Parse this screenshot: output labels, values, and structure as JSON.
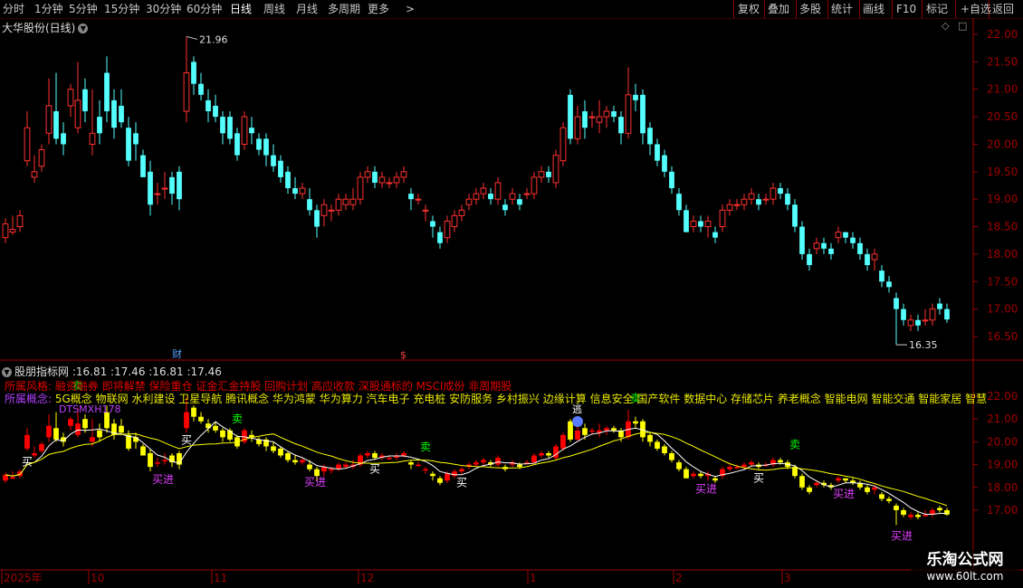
{
  "toolbar": {
    "periods": [
      "分时",
      "1分钟",
      "5分钟",
      "15分钟",
      "30分钟",
      "60分钟",
      "日线",
      "周线",
      "月线",
      "多周期",
      "更多"
    ],
    "active_period": "日线",
    "more_arrow": ">",
    "buttons": [
      "复权",
      "叠加",
      "多股",
      "统计",
      "画线",
      "F10",
      "标记",
      "+自选",
      "返回"
    ]
  },
  "main_panel": {
    "title": "大华股份(日线)",
    "price_ticks": [
      "22.00",
      "21.50",
      "21.00",
      "20.50",
      "20.00",
      "19.50",
      "19.00",
      "18.50",
      "18.00",
      "17.50",
      "17.00",
      "16.50"
    ],
    "high_label": "21.96",
    "low_label": "16.35",
    "event_markers": [
      "财",
      "$"
    ]
  },
  "indicator_panel": {
    "title": "股朋指标网",
    "values": ":16.81 :17.46 :16.81 :17.46",
    "style_label": "所属风格:",
    "style_text": "融资融券 即将解禁 保险重仓 证金汇金持股 回购计划 高应收款 深股通标的 MSCI成份 非周期股",
    "concept_label": "所属概念:",
    "concept_text": "5G概念 物联网 水利建设 卫星导航 腾讯概念 华为鸿蒙 华为算力 汽车电子 充电桩 安防服务 乡村振兴 边缘计算 信息安全 国产软件 数据中心 存储芯片 养老概念 智能电网 智能交通 智能家居 智慧",
    "indicator_name": "DTSMXH178",
    "price_ticks": [
      "22.00",
      "21.00",
      "20.00",
      "19.00",
      "18.00",
      "17.00"
    ],
    "signals": {
      "buy": "买",
      "sell": "卖",
      "buy_in": "买进",
      "escape": "逃"
    }
  },
  "x_axis": {
    "labels": [
      "2025年",
      "10",
      "11",
      "12",
      "1",
      "2",
      "3"
    ]
  },
  "watermark": {
    "line1": "乐淘公式网",
    "line2": "www.60lt.com"
  },
  "colors": {
    "up": "#ff3030",
    "down": "#54ffff",
    "ind_up": "#ff0000",
    "ind_down": "#ffff00",
    "ma_fast": "#ffffff",
    "ma_slow": "#ffff00",
    "border": "#a00000"
  },
  "chart_data": {
    "type": "candlestick",
    "ylim": [
      16.2,
      22.2
    ],
    "candles": [
      [
        18.3,
        18.55,
        18.65,
        18.2
      ],
      [
        18.4,
        18.45,
        18.7,
        18.35
      ],
      [
        18.5,
        18.7,
        18.8,
        18.4
      ],
      [
        19.7,
        20.3,
        20.6,
        19.6
      ],
      [
        19.4,
        19.5,
        19.8,
        19.3
      ],
      [
        19.6,
        19.9,
        20.0,
        19.5
      ],
      [
        20.2,
        20.7,
        21.2,
        20.0
      ],
      [
        20.6,
        20.1,
        21.3,
        20.0
      ],
      [
        20.2,
        20.0,
        20.4,
        19.8
      ],
      [
        20.7,
        21.0,
        21.1,
        20.5
      ],
      [
        20.3,
        20.8,
        21.5,
        20.2
      ],
      [
        21.0,
        20.6,
        21.2,
        20.4
      ],
      [
        20.0,
        20.2,
        21.0,
        19.8
      ],
      [
        20.5,
        20.2,
        20.8,
        20.0
      ],
      [
        21.3,
        20.6,
        21.6,
        20.4
      ],
      [
        20.8,
        20.3,
        21.0,
        20.1
      ],
      [
        20.7,
        20.4,
        21.0,
        20.3
      ],
      [
        20.3,
        19.7,
        20.5,
        19.6
      ],
      [
        20.2,
        20.0,
        20.4,
        19.7
      ],
      [
        19.8,
        19.4,
        19.9,
        19.4
      ],
      [
        19.5,
        18.9,
        19.7,
        18.7
      ],
      [
        19.1,
        19.1,
        19.3,
        18.9
      ],
      [
        19.2,
        19.2,
        19.5,
        19.0
      ],
      [
        19.4,
        19.1,
        19.5,
        18.9
      ],
      [
        19.5,
        19.0,
        19.6,
        18.8
      ],
      [
        20.6,
        21.3,
        21.96,
        20.4
      ],
      [
        21.5,
        21.1,
        21.6,
        20.9
      ],
      [
        21.1,
        20.9,
        21.3,
        20.8
      ],
      [
        20.8,
        20.6,
        21.0,
        20.4
      ],
      [
        20.7,
        20.5,
        20.9,
        20.4
      ],
      [
        20.5,
        20.2,
        20.6,
        20.0
      ],
      [
        20.5,
        20.1,
        20.6,
        20.0
      ],
      [
        20.2,
        19.8,
        20.3,
        19.7
      ],
      [
        20.0,
        20.5,
        20.6,
        19.9
      ],
      [
        20.3,
        20.2,
        20.5,
        20.0
      ],
      [
        20.1,
        19.9,
        20.2,
        19.8
      ],
      [
        20.1,
        19.8,
        20.2,
        19.6
      ],
      [
        19.8,
        19.6,
        20.0,
        19.5
      ],
      [
        19.7,
        19.4,
        19.8,
        19.3
      ],
      [
        19.5,
        19.2,
        19.6,
        19.1
      ],
      [
        19.2,
        19.1,
        19.4,
        19.0
      ],
      [
        19.1,
        19.2,
        19.3,
        19.0
      ],
      [
        19.0,
        18.8,
        19.2,
        18.7
      ],
      [
        18.8,
        18.5,
        18.9,
        18.3
      ],
      [
        18.7,
        18.9,
        19.0,
        18.5
      ],
      [
        18.8,
        18.8,
        18.9,
        18.6
      ],
      [
        18.8,
        19.0,
        19.1,
        18.7
      ],
      [
        18.9,
        19.0,
        19.1,
        18.8
      ],
      [
        18.9,
        19.0,
        19.2,
        18.8
      ],
      [
        19.0,
        19.4,
        19.5,
        18.9
      ],
      [
        19.4,
        19.5,
        19.6,
        19.3
      ],
      [
        19.5,
        19.3,
        19.6,
        19.2
      ],
      [
        19.3,
        19.4,
        19.5,
        19.2
      ],
      [
        19.3,
        19.3,
        19.4,
        19.2
      ],
      [
        19.3,
        19.4,
        19.5,
        19.2
      ],
      [
        19.4,
        19.5,
        19.6,
        19.3
      ],
      [
        19.1,
        19.0,
        19.2,
        18.8
      ],
      [
        19.0,
        19.0,
        19.1,
        18.9
      ],
      [
        18.8,
        18.8,
        18.9,
        18.6
      ],
      [
        18.6,
        18.5,
        18.7,
        18.3
      ],
      [
        18.4,
        18.2,
        18.5,
        18.1
      ],
      [
        18.3,
        18.6,
        18.7,
        18.2
      ],
      [
        18.5,
        18.7,
        18.8,
        18.4
      ],
      [
        18.7,
        18.8,
        18.9,
        18.6
      ],
      [
        18.9,
        19.0,
        19.1,
        18.8
      ],
      [
        19.0,
        19.1,
        19.2,
        18.9
      ],
      [
        19.1,
        19.2,
        19.3,
        19.0
      ],
      [
        19.1,
        19.0,
        19.2,
        18.9
      ],
      [
        19.0,
        19.3,
        19.4,
        18.9
      ],
      [
        18.9,
        18.8,
        19.0,
        18.7
      ],
      [
        19.0,
        19.1,
        19.2,
        18.9
      ],
      [
        19.0,
        18.9,
        19.1,
        18.8
      ],
      [
        19.1,
        19.1,
        19.2,
        19.0
      ],
      [
        19.1,
        19.4,
        19.5,
        19.0
      ],
      [
        19.4,
        19.5,
        19.6,
        19.3
      ],
      [
        19.5,
        19.4,
        19.6,
        19.3
      ],
      [
        19.3,
        19.8,
        19.9,
        19.2
      ],
      [
        19.7,
        20.3,
        20.4,
        19.6
      ],
      [
        20.9,
        20.1,
        21.0,
        20.0
      ],
      [
        20.1,
        20.5,
        20.7,
        20.0
      ],
      [
        20.6,
        20.3,
        20.8,
        20.1
      ],
      [
        20.5,
        20.5,
        20.6,
        20.3
      ],
      [
        20.4,
        20.5,
        20.8,
        20.2
      ],
      [
        20.5,
        20.6,
        20.7,
        20.3
      ],
      [
        20.6,
        20.5,
        20.7,
        20.4
      ],
      [
        20.5,
        20.2,
        20.6,
        20.0
      ],
      [
        20.2,
        20.9,
        21.4,
        20.1
      ],
      [
        20.9,
        20.8,
        21.1,
        20.6
      ],
      [
        20.9,
        20.2,
        21.0,
        20.0
      ],
      [
        20.3,
        20.0,
        20.4,
        19.8
      ],
      [
        20.0,
        19.7,
        20.1,
        19.6
      ],
      [
        19.8,
        19.5,
        19.9,
        19.4
      ],
      [
        19.5,
        19.2,
        19.6,
        19.1
      ],
      [
        19.1,
        18.8,
        19.2,
        18.7
      ],
      [
        18.8,
        18.4,
        18.9,
        18.4
      ],
      [
        18.5,
        18.6,
        18.7,
        18.4
      ],
      [
        18.6,
        18.5,
        18.7,
        18.4
      ],
      [
        18.5,
        18.6,
        18.7,
        18.3
      ],
      [
        18.4,
        18.3,
        18.5,
        18.2
      ],
      [
        18.5,
        18.8,
        18.9,
        18.4
      ],
      [
        18.8,
        18.9,
        19.0,
        18.7
      ],
      [
        18.9,
        18.9,
        19.0,
        18.8
      ],
      [
        18.9,
        19.0,
        19.1,
        18.8
      ],
      [
        19.0,
        19.1,
        19.2,
        18.9
      ],
      [
        19.0,
        18.9,
        19.1,
        18.8
      ],
      [
        19.0,
        19.0,
        19.1,
        18.9
      ],
      [
        19.0,
        19.2,
        19.3,
        18.9
      ],
      [
        19.2,
        19.1,
        19.3,
        19.0
      ],
      [
        19.1,
        18.9,
        19.2,
        18.8
      ],
      [
        18.9,
        18.5,
        19.0,
        18.4
      ],
      [
        18.5,
        18.0,
        18.6,
        17.9
      ],
      [
        18.0,
        17.8,
        18.1,
        17.7
      ],
      [
        18.1,
        18.2,
        18.3,
        18.0
      ],
      [
        18.2,
        18.1,
        18.3,
        18.0
      ],
      [
        18.1,
        18.0,
        18.2,
        17.9
      ],
      [
        18.3,
        18.4,
        18.5,
        18.2
      ],
      [
        18.4,
        18.3,
        18.4,
        18.2
      ],
      [
        18.3,
        18.2,
        18.4,
        18.1
      ],
      [
        18.2,
        18.0,
        18.3,
        17.9
      ],
      [
        18.0,
        17.8,
        18.1,
        17.7
      ],
      [
        17.9,
        18.0,
        18.1,
        17.7
      ],
      [
        17.7,
        17.5,
        17.8,
        17.4
      ],
      [
        17.5,
        17.4,
        17.6,
        17.3
      ],
      [
        17.2,
        17.0,
        17.3,
        16.35
      ],
      [
        17.0,
        16.8,
        17.1,
        16.7
      ],
      [
        16.7,
        16.8,
        16.9,
        16.6
      ],
      [
        16.8,
        16.7,
        16.9,
        16.6
      ],
      [
        16.8,
        16.8,
        17.0,
        16.7
      ],
      [
        16.8,
        17.0,
        17.1,
        16.7
      ],
      [
        17.1,
        17.0,
        17.2,
        16.9
      ],
      [
        17.0,
        16.81,
        17.1,
        16.75
      ]
    ]
  }
}
